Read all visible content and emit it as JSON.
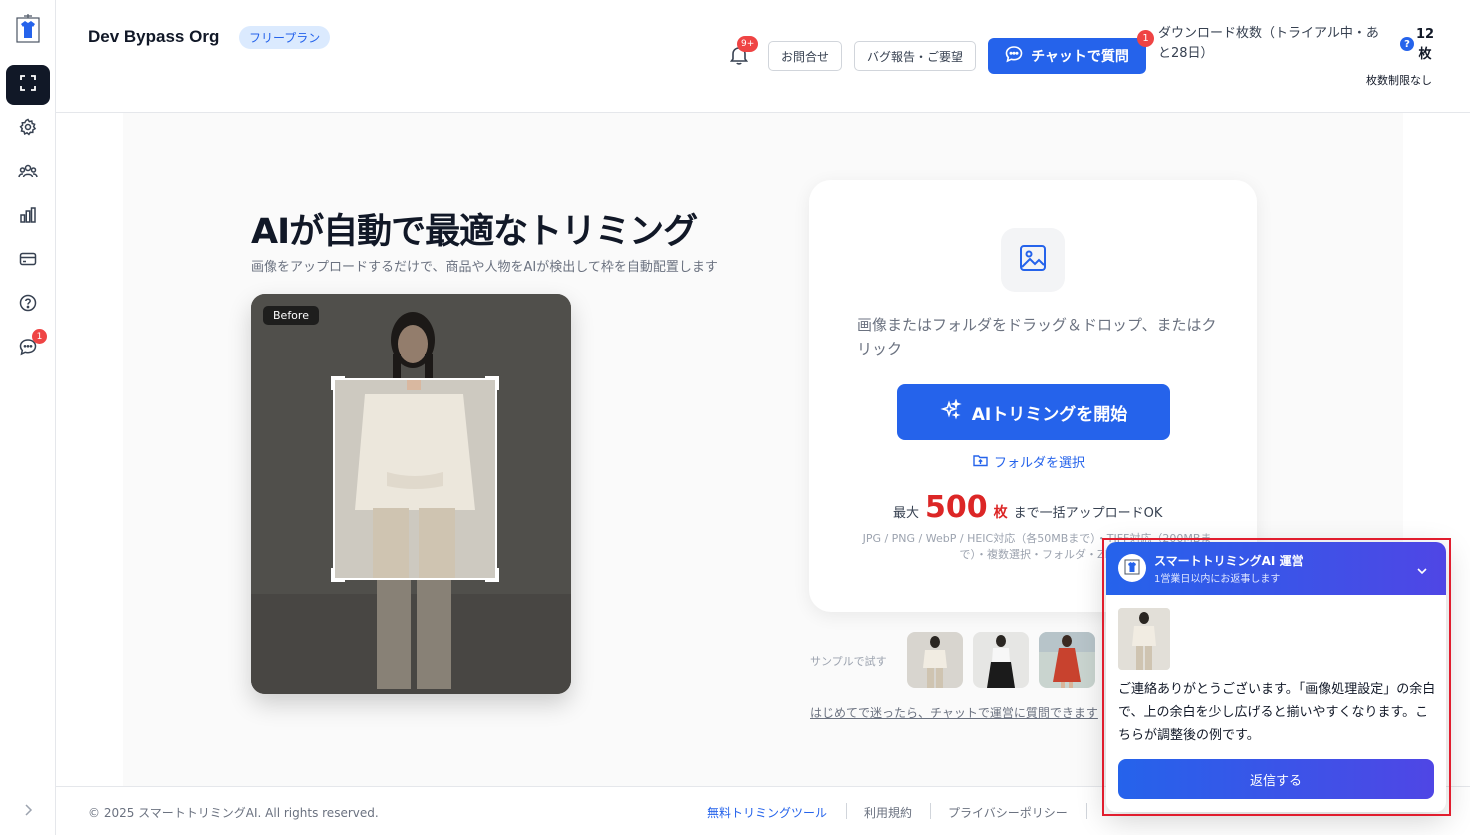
{
  "org": {
    "name": "Dev Bypass Org",
    "plan": "フリープラン"
  },
  "header": {
    "notifications_badge": "9+",
    "contact_label": "お問合せ",
    "bug_label": "バグ報告・ご要望",
    "chat_label": "チャットで質問",
    "chat_badge": "1",
    "download_text": "ダウンロード枚数（トライアル中・あと28日）",
    "help_glyph": "?",
    "count_value": "12",
    "count_unit": "枚",
    "limit_text": "枚数制限なし"
  },
  "sidebar": {
    "items": [
      {
        "icon": "crop-icon",
        "active": true
      },
      {
        "icon": "gear-icon"
      },
      {
        "icon": "users-icon"
      },
      {
        "icon": "bar-chart-icon"
      },
      {
        "icon": "card-icon"
      },
      {
        "icon": "help-circle-icon"
      },
      {
        "icon": "chat-bubble-icon",
        "badge": "1"
      }
    ]
  },
  "hero": {
    "title": "AIが自動で最適なトリミング",
    "subtitle": "画像をアップロードするだけで、商品や人物をAIが検出して枠を自動配置します",
    "before_tag": "Before"
  },
  "upload": {
    "drop_text": "画像またはフォルダをドラッグ＆ドロップ、またはクリック",
    "start_label": "AIトリミングを開始",
    "folder_label": "フォルダを選択",
    "max_prefix": "最大",
    "max_count": "500",
    "max_unit": "枚",
    "max_suffix": "まで一括アップロードOK",
    "formats": "JPG / PNG / WebP / HEIC対応（各50MBまで）・TIFF対応（200MBまで）・複数選択・フォルダ・ZIP"
  },
  "samples": {
    "label": "サンプルで試す",
    "first_time": "はじめてで迷ったら、チャットで運営に質問できます"
  },
  "footer": {
    "copyright": "© 2025 スマートトリミングAI. All rights reserved.",
    "links": [
      "無料トリミングツール",
      "利用規約",
      "プライバシーポリシー"
    ]
  },
  "chat_widget": {
    "title": "スマートトリミングAI 運営",
    "subtitle": "1営業日以内にお返事します",
    "message": "ご連絡ありがとうございます。「画像処理設定」の余白で、上の余白を少し広げると揃いやすくなります。こちらが調整後の例です。",
    "reply_label": "返信する"
  },
  "colors": {
    "primary": "#2563eb",
    "danger": "#dc2626",
    "highlight": "#e11d2e"
  }
}
